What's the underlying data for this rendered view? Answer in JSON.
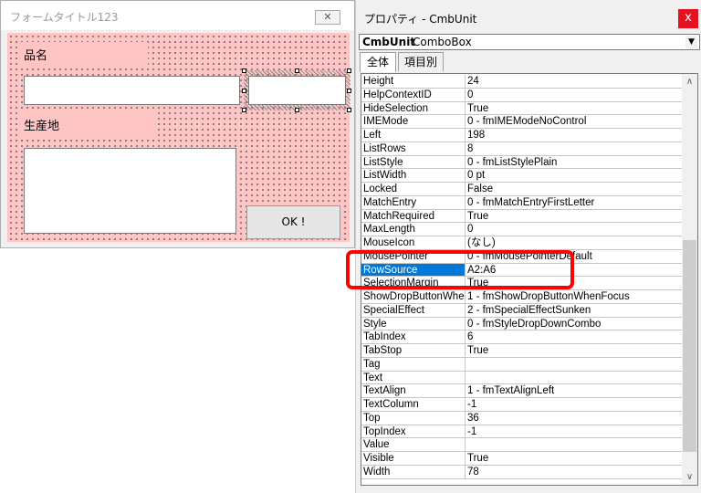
{
  "form": {
    "title": "フォームタイトル123",
    "close_glyph": "✕",
    "label_name": "品名",
    "label_origin": "生産地",
    "ok_label": "OK !"
  },
  "properties": {
    "window_title": "プロパティ - CmbUnit",
    "close_glyph": "x",
    "object_name": "CmbUnit",
    "object_type": "ComboBox",
    "tabs": [
      "全体",
      "項目別"
    ],
    "rows": [
      {
        "name": "Height",
        "value": "24"
      },
      {
        "name": "HelpContextID",
        "value": "0"
      },
      {
        "name": "HideSelection",
        "value": "True"
      },
      {
        "name": "IMEMode",
        "value": "0 - fmIMEModeNoControl"
      },
      {
        "name": "Left",
        "value": "198"
      },
      {
        "name": "ListRows",
        "value": "8"
      },
      {
        "name": "ListStyle",
        "value": "0 - fmListStylePlain"
      },
      {
        "name": "ListWidth",
        "value": "0 pt"
      },
      {
        "name": "Locked",
        "value": "False"
      },
      {
        "name": "MatchEntry",
        "value": "0 - fmMatchEntryFirstLetter"
      },
      {
        "name": "MatchRequired",
        "value": "True"
      },
      {
        "name": "MaxLength",
        "value": "0"
      },
      {
        "name": "MouseIcon",
        "value": "(なし)"
      },
      {
        "name": "MousePointer",
        "value": "0 - fmMousePointerDefault"
      },
      {
        "name": "RowSource",
        "value": "A2:A6"
      },
      {
        "name": "SelectionMargin",
        "value": "True"
      },
      {
        "name": "ShowDropButtonWhen",
        "value": "1 - fmShowDropButtonWhenFocus"
      },
      {
        "name": "SpecialEffect",
        "value": "2 - fmSpecialEffectSunken"
      },
      {
        "name": "Style",
        "value": "0 - fmStyleDropDownCombo"
      },
      {
        "name": "TabIndex",
        "value": "6"
      },
      {
        "name": "TabStop",
        "value": "True"
      },
      {
        "name": "Tag",
        "value": ""
      },
      {
        "name": "Text",
        "value": ""
      },
      {
        "name": "TextAlign",
        "value": "1 - fmTextAlignLeft"
      },
      {
        "name": "TextColumn",
        "value": "-1"
      },
      {
        "name": "Top",
        "value": "36"
      },
      {
        "name": "TopIndex",
        "value": "-1"
      },
      {
        "name": "Value",
        "value": ""
      },
      {
        "name": "Visible",
        "value": "True"
      },
      {
        "name": "Width",
        "value": "78"
      }
    ],
    "selected_row": "RowSource"
  },
  "colors": {
    "form_background": "#ffc4c4",
    "selection": "#0078d7",
    "highlight": "#ff0000",
    "close_button": "#e81123"
  }
}
